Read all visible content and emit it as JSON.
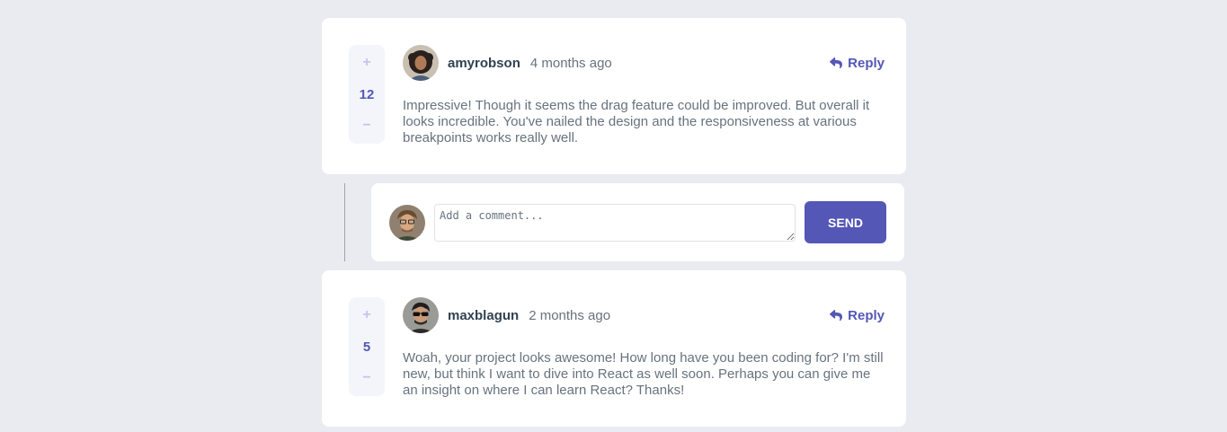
{
  "comments": [
    {
      "score": "12",
      "upvote_symbol": "+",
      "downvote_symbol": "−",
      "username": "amyrobson",
      "created_at": "4 months ago",
      "reply_label": "Reply",
      "content": "Impressive! Though it seems the drag feature could be improved. But overall it looks incredible. You've nailed the design and the responsiveness at various breakpoints works really well."
    },
    {
      "score": "5",
      "upvote_symbol": "+",
      "downvote_symbol": "−",
      "username": "maxblagun",
      "created_at": "2 months ago",
      "reply_label": "Reply",
      "content": "Woah, your project looks awesome! How long have you been coding for? I'm still new, but think I want to dive into React as well soon. Perhaps you can give me an insight on where I can learn React? Thanks!"
    }
  ],
  "reply_form": {
    "placeholder": "Add a comment...",
    "value": "",
    "send_label": "SEND"
  },
  "icons": {
    "reply": "reply-arrow-icon",
    "upvote": "plus-icon",
    "downvote": "minus-icon"
  },
  "colors": {
    "background": "#eaebf0",
    "card": "#ffffff",
    "accent": "#5457b6",
    "vote_button": "#c3c4ee",
    "vote_bg": "#f4f5fa",
    "username": "#324152",
    "body_text": "#67727e"
  }
}
